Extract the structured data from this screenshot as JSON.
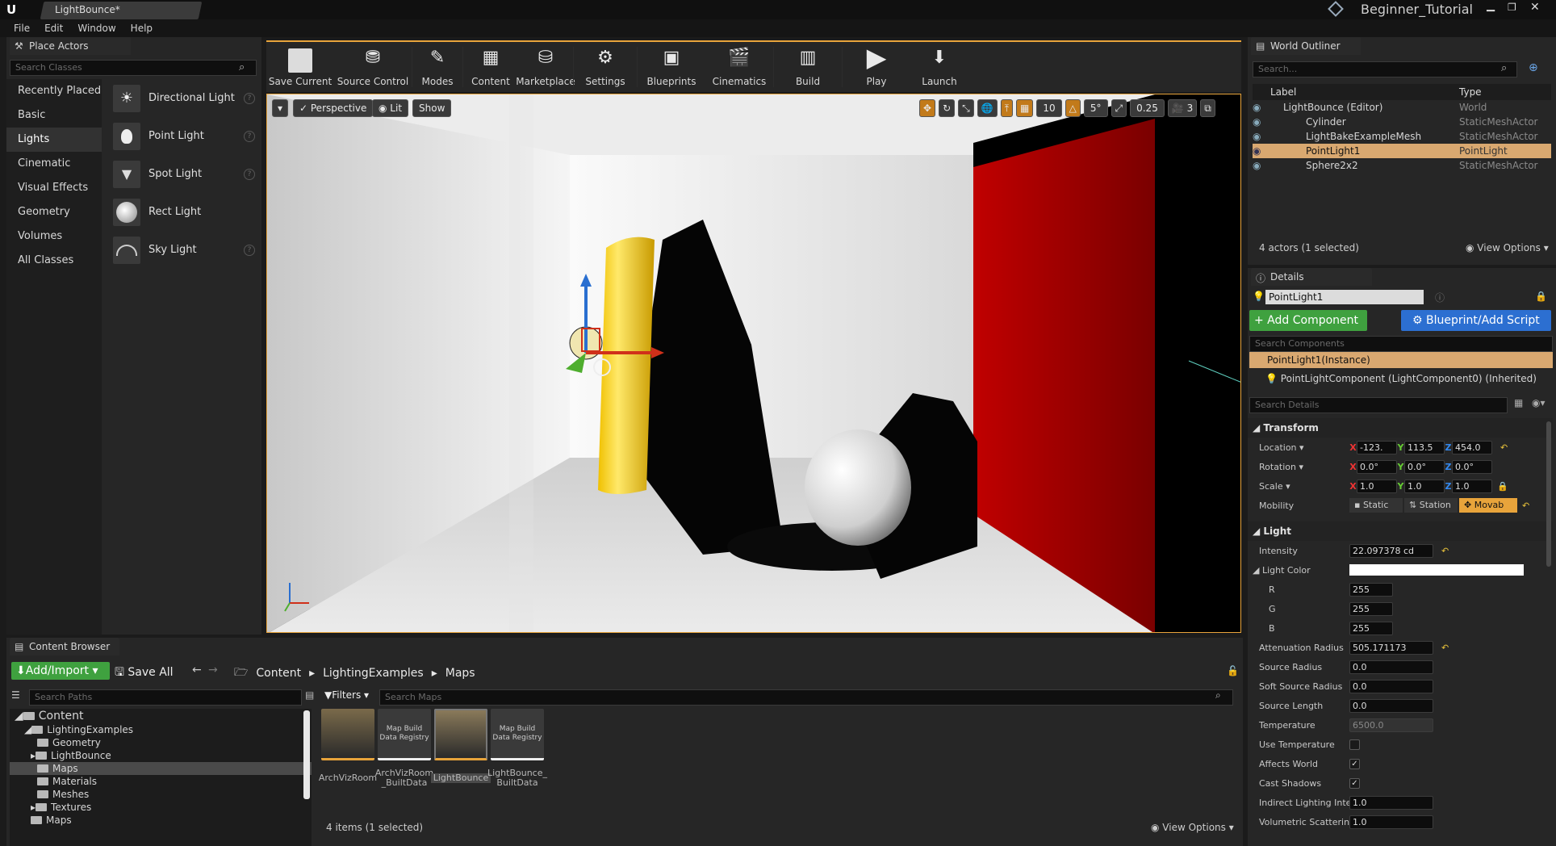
{
  "app": {
    "tab_title": "LightBounce*",
    "project": "Beginner_Tutorial"
  },
  "menu": [
    "File",
    "Edit",
    "Window",
    "Help"
  ],
  "place_actors": {
    "tab": "Place Actors",
    "search_placeholder": "Search Classes",
    "categories": [
      "Recently Placed",
      "Basic",
      "Lights",
      "Cinematic",
      "Visual Effects",
      "Geometry",
      "Volumes",
      "All Classes"
    ],
    "active_category": "Lights",
    "items": [
      "Directional Light",
      "Point Light",
      "Spot Light",
      "Rect Light",
      "Sky Light"
    ]
  },
  "toolbar": [
    {
      "label": "Save Current",
      "icon": "save-icon"
    },
    {
      "label": "Source Control",
      "icon": "source-control-icon"
    },
    {
      "label": "Modes",
      "icon": "modes-icon"
    },
    {
      "label": "Content",
      "icon": "content-icon"
    },
    {
      "label": "Marketplace",
      "icon": "marketplace-icon"
    },
    {
      "label": "Settings",
      "icon": "settings-icon"
    },
    {
      "label": "Blueprints",
      "icon": "blueprints-icon"
    },
    {
      "label": "Cinematics",
      "icon": "cinematics-icon"
    },
    {
      "label": "Build",
      "icon": "build-icon"
    },
    {
      "label": "Play",
      "icon": "play-icon"
    },
    {
      "label": "Launch",
      "icon": "launch-icon"
    }
  ],
  "viewport": {
    "perspective": "Perspective",
    "lit": "Lit",
    "show": "Show",
    "grid": "10",
    "angle": "5°",
    "scale": "0.25",
    "speed": "3"
  },
  "outliner": {
    "tab": "World Outliner",
    "search_placeholder": "Search...",
    "col_label": "Label",
    "col_type": "Type",
    "rows": [
      {
        "label": "LightBounce (Editor)",
        "type": "World"
      },
      {
        "label": "Cylinder",
        "type": "StaticMeshActor"
      },
      {
        "label": "LightBakeExampleMesh",
        "type": "StaticMeshActor"
      },
      {
        "label": "PointLight1",
        "type": "PointLight"
      },
      {
        "label": "Sphere2x2",
        "type": "StaticMeshActor"
      }
    ],
    "status": "4 actors (1 selected)",
    "view_options": "View Options"
  },
  "details": {
    "tab": "Details",
    "name": "PointLight1",
    "add_component": "+ Add Component",
    "blueprint": "Blueprint/Add Script",
    "search_components": "Search Components",
    "instance": "PointLight1(Instance)",
    "component": "PointLightComponent (LightComponent0) (Inherited)",
    "search_details": "Search Details",
    "transform": "Transform",
    "location_label": "Location",
    "rotation_label": "Rotation",
    "scale_label": "Scale",
    "mobility_label": "Mobility",
    "location": [
      "-123.",
      "113.5",
      "454.0"
    ],
    "rotation": [
      "0.0°",
      "0.0°",
      "0.0°"
    ],
    "scale": [
      "1.0",
      "1.0",
      "1.0"
    ],
    "mobility": [
      "Static",
      "Station",
      "Movab"
    ],
    "light_section": "Light",
    "props": [
      {
        "label": "Intensity",
        "value": "22.097378 cd"
      },
      {
        "label": "Light Color",
        "value": ""
      },
      {
        "label": "R",
        "value": "255"
      },
      {
        "label": "G",
        "value": "255"
      },
      {
        "label": "B",
        "value": "255"
      },
      {
        "label": "Attenuation Radius",
        "value": "505.171173"
      },
      {
        "label": "Source Radius",
        "value": "0.0"
      },
      {
        "label": "Soft Source Radius",
        "value": "0.0"
      },
      {
        "label": "Source Length",
        "value": "0.0"
      },
      {
        "label": "Temperature",
        "value": "6500.0"
      },
      {
        "label": "Use Temperature",
        "value": ""
      },
      {
        "label": "Affects World",
        "value": ""
      },
      {
        "label": "Cast Shadows",
        "value": ""
      },
      {
        "label": "Indirect Lighting Intens",
        "value": "1.0"
      },
      {
        "label": "Volumetric Scattering",
        "value": "1.0"
      }
    ]
  },
  "content_browser": {
    "tab": "Content Browser",
    "add_import": "Add/Import",
    "save_all": "Save All",
    "breadcrumb": [
      "Content",
      "LightingExamples",
      "Maps"
    ],
    "search_paths": "Search Paths",
    "filters": "Filters",
    "search_maps": "Search Maps",
    "tree": [
      "Content",
      "LightingExamples",
      "Geometry",
      "LightBounce",
      "Maps",
      "Materials",
      "Meshes",
      "Textures",
      "Maps"
    ],
    "assets": [
      {
        "label": "ArchVizRoom",
        "overlay": ""
      },
      {
        "label": "ArchVizRoom _BuiltData",
        "overlay": "Map Build Data Registry"
      },
      {
        "label": "LightBounce",
        "overlay": ""
      },
      {
        "label": "LightBounce_ BuiltData",
        "overlay": "Map Build Data Registry"
      }
    ],
    "status": "4 items (1 selected)",
    "view_options": "View Options"
  },
  "colors": {
    "accent": "#e8a43b",
    "selection": "#d9a870",
    "green": "#3fa13f",
    "blue": "#2c6fd1",
    "red_wall": "#9e0000"
  }
}
